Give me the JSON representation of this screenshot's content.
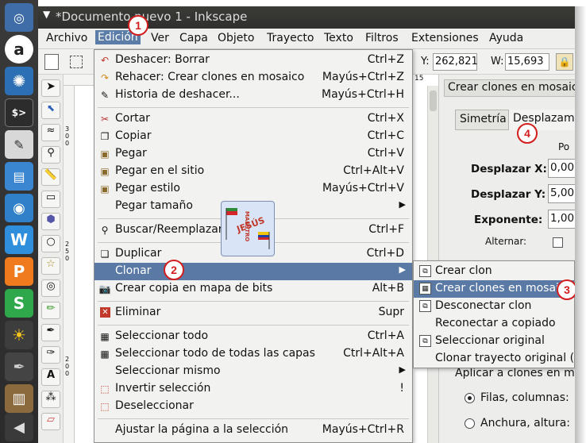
{
  "window": {
    "title": "*Documento nuevo 1 - Inkscape"
  },
  "menubar": [
    "Archivo",
    "Edición",
    "Ver",
    "Capa",
    "Objeto",
    "Trayecto",
    "Texto",
    "Filtros",
    "Extensiones",
    "Ayuda"
  ],
  "toolbar": {
    "y_label": "Y:",
    "y_value": "262,821",
    "w_label": "W:",
    "w_value": "15,693"
  },
  "ruler": {
    "left_ticks": [
      "3 0 0",
      "2 5 0",
      "2 0 0"
    ],
    "top_tick": "15"
  },
  "edit_menu": [
    {
      "label": "Deshacer: Borrar",
      "shortcut": "Ctrl+Z",
      "icon": "undo-icon"
    },
    {
      "label": "Rehacer: Crear clones en mosaico",
      "shortcut": "Mayús+Ctrl+Z",
      "icon": "redo-icon"
    },
    {
      "label": "Historia de deshacer...",
      "shortcut": "Mayús+Ctrl+H",
      "icon": "history-icon"
    },
    {
      "label": "Cortar",
      "shortcut": "Ctrl+X",
      "icon": "cut-icon"
    },
    {
      "label": "Copiar",
      "shortcut": "Ctrl+C",
      "icon": "copy-icon"
    },
    {
      "label": "Pegar",
      "shortcut": "Ctrl+V",
      "icon": "paste-icon"
    },
    {
      "label": "Pegar en el sitio",
      "shortcut": "Ctrl+Alt+V",
      "icon": "paste-in-place-icon"
    },
    {
      "label": "Pegar estilo",
      "shortcut": "Mayús+Ctrl+V",
      "icon": "paste-style-icon"
    },
    {
      "label": "Pegar tamaño",
      "shortcut": "",
      "icon": ""
    },
    {
      "label": "Buscar/Reemplazar",
      "shortcut": "Ctrl+F",
      "icon": "find-icon"
    },
    {
      "label": "Duplicar",
      "shortcut": "Ctrl+D",
      "icon": "duplicate-icon"
    },
    {
      "label": "Clonar",
      "shortcut": "",
      "icon": ""
    },
    {
      "label": "Crear copia en mapa de bits",
      "shortcut": "Alt+B",
      "icon": "bitmap-icon"
    },
    {
      "label": "Eliminar",
      "shortcut": "Supr",
      "icon": "delete-icon"
    },
    {
      "label": "Seleccionar todo",
      "shortcut": "Ctrl+A",
      "icon": "select-all-icon"
    },
    {
      "label": "Seleccionar todo de todas las capas",
      "shortcut": "Ctrl+Alt+A",
      "icon": "select-all-layers-icon"
    },
    {
      "label": "Seleccionar mismo",
      "shortcut": "",
      "icon": ""
    },
    {
      "label": "Invertir selección",
      "shortcut": "!",
      "icon": "invert-selection-icon"
    },
    {
      "label": "Deseleccionar",
      "shortcut": "",
      "icon": "deselect-icon"
    },
    {
      "label": "Ajustar la página a la selección",
      "shortcut": "Mayús+Ctrl+R",
      "icon": ""
    }
  ],
  "clone_submenu": [
    {
      "label": "Crear clon"
    },
    {
      "label": "Crear clones en mosaico"
    },
    {
      "label": "Desconectar clon"
    },
    {
      "label": "Reconectar a copiado"
    },
    {
      "label": "Seleccionar original"
    },
    {
      "label": "Clonar trayecto original (LPE)"
    }
  ],
  "dock": {
    "title": "Crear clones en mosaico",
    "tab_symmetry": "Simetría",
    "tab_shift": "Desplazamiento",
    "po_label": "Po",
    "shift_x_label": "Desplazar X:",
    "shift_x_value": "0,00",
    "shift_y_label": "Desplazar Y:",
    "shift_y_value": "5,00",
    "exponent_label": "Exponente:",
    "exponent_value": "1,00",
    "alternate_label": "Alternar:",
    "apply_label": "Aplicar a clones en mosaico:",
    "rows_cols_label": "Filas, columnas:",
    "width_height_label": "Anchura, altura:"
  },
  "logo_text": "JESÚS MAESTRO",
  "annotations": [
    "1",
    "2",
    "3",
    "4"
  ],
  "colors": {
    "highlight": "#5a7aa5",
    "badge": "#d21e1e"
  }
}
